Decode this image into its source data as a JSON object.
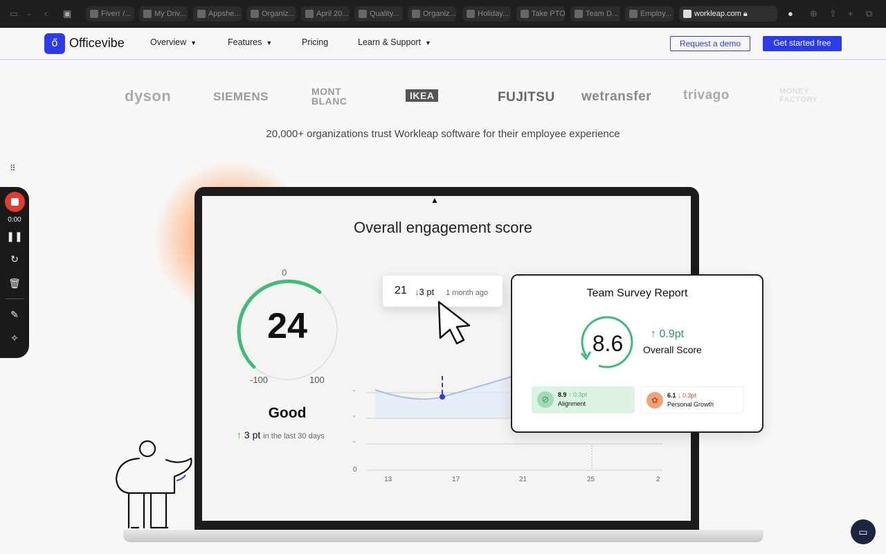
{
  "browser": {
    "tabs": [
      {
        "label": "Fiverr /..."
      },
      {
        "label": "My Driv..."
      },
      {
        "label": "Appshe..."
      },
      {
        "label": "Organiz..."
      },
      {
        "label": "April 20..."
      },
      {
        "label": "Quality..."
      },
      {
        "label": "Organiz..."
      },
      {
        "label": "Holiday..."
      },
      {
        "label": "Take PTO"
      },
      {
        "label": "Team D..."
      },
      {
        "label": "Employ..."
      }
    ],
    "url": "workleap.com"
  },
  "nav": {
    "brand": "Officevibe",
    "brand_color": "#2a3bea",
    "links": [
      "Overview",
      "Features",
      "Pricing",
      "Learn & Support"
    ],
    "demo": "Request a demo",
    "start": "Get started free"
  },
  "logos": [
    "dyson",
    "SIEMENS",
    "MONT BLANC",
    "IKEA",
    "FUJITSU",
    "wetransfer",
    "trivago",
    "MONEY FACTORY"
  ],
  "tagline": "20,000+ organizations trust Workleap software for their employee experience",
  "dashboard": {
    "title": "Overall engagement score",
    "gauge": {
      "value": "24",
      "top": "0",
      "min": "-100",
      "max": "100",
      "label": "Good",
      "change": "3 pt",
      "period": "in the last 30 days"
    },
    "tooltip": {
      "value": "21",
      "change": "3 pt",
      "when": "1 month ago"
    },
    "chart": {
      "x_ticks": [
        "13",
        "17",
        "21",
        "25",
        "2"
      ],
      "y_ticks": [
        "-",
        "-",
        "-",
        "0"
      ]
    }
  },
  "survey": {
    "title": "Team Survey Report",
    "score": "8.6",
    "change": "0.9pt",
    "label": "Overall Score",
    "items": [
      {
        "value": "8.9",
        "change": "0.3pt",
        "name": "Alignment",
        "dir": "up"
      },
      {
        "value": "6.1",
        "change": "0.3pt",
        "name": "Personal Growth",
        "dir": "down"
      }
    ]
  },
  "recorder": {
    "time": "0:00"
  }
}
